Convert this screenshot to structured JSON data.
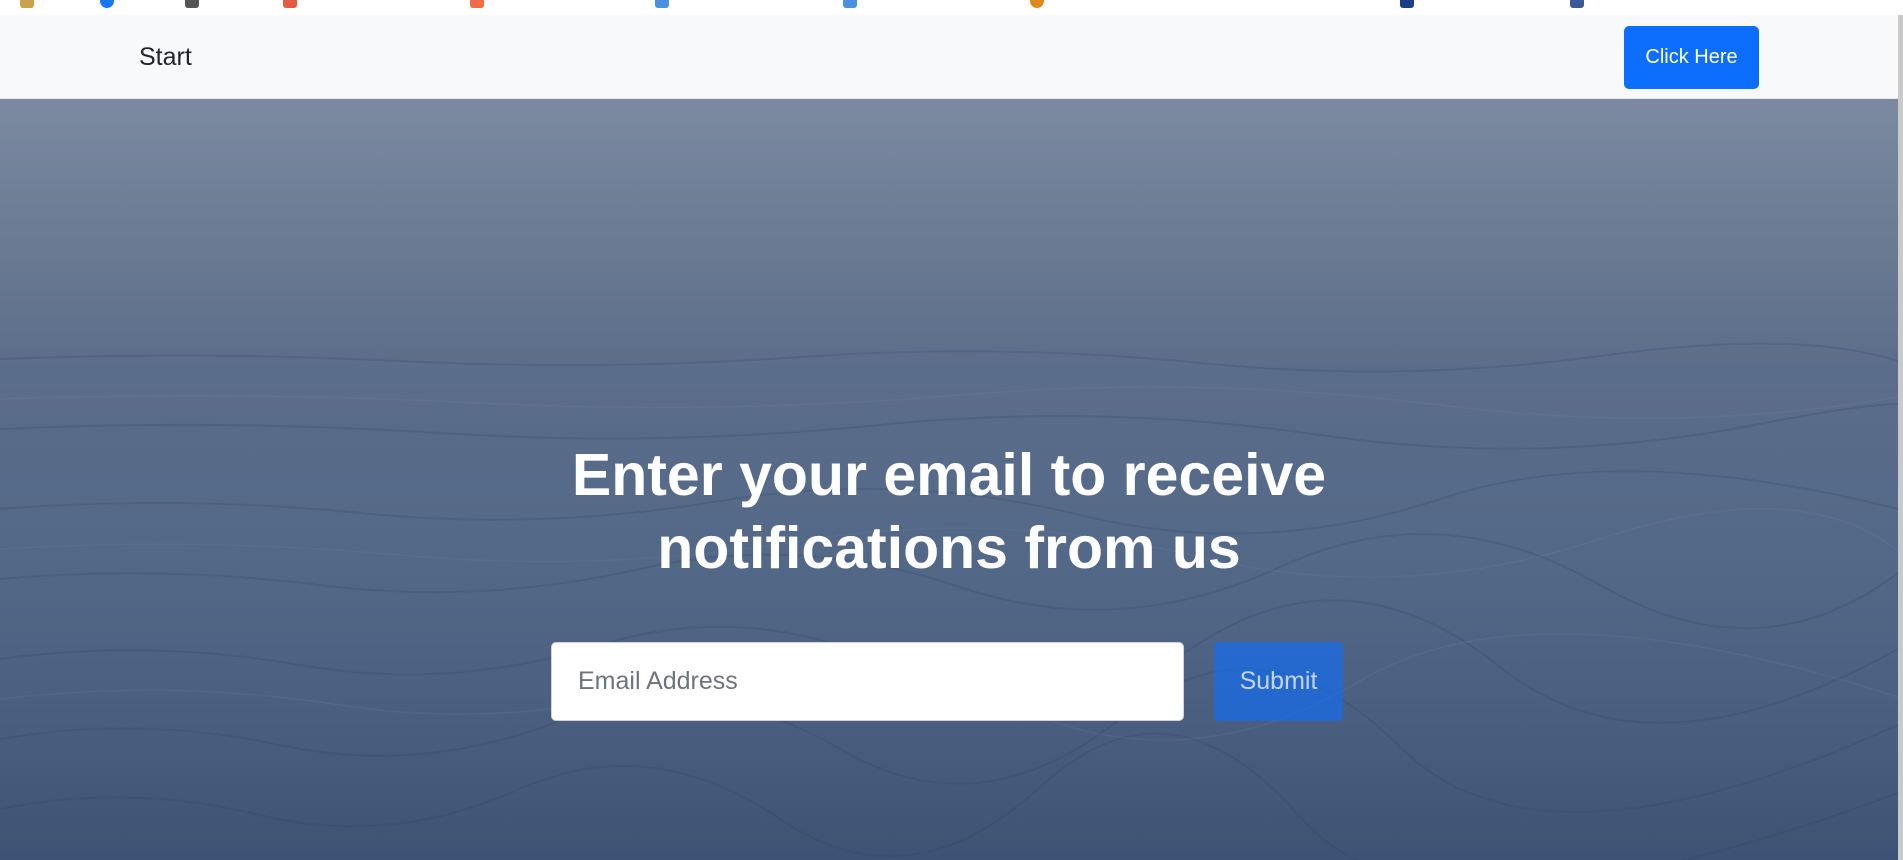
{
  "navbar": {
    "brand_label": "Start",
    "cta_label": "Click Here"
  },
  "hero": {
    "headline_line1": "Enter your email to receive",
    "headline_line2": "notifications from us",
    "email_field": {
      "placeholder": "Email Address",
      "value": ""
    },
    "submit_label": "Submit"
  },
  "colors": {
    "primary": "#0d6efd",
    "navbar_bg": "#f8f9fa",
    "hero_top": "#6d7d97",
    "hero_bottom": "#44597c",
    "text_dark": "#212529",
    "text_light": "#ffffff"
  }
}
